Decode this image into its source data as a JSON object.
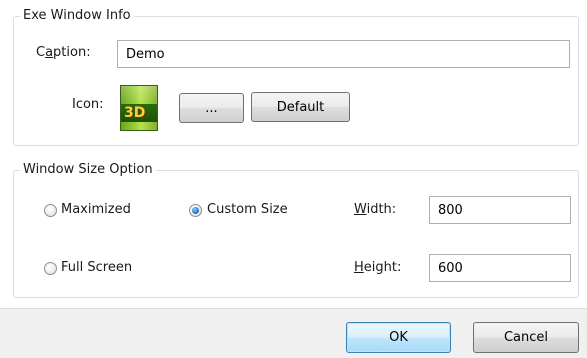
{
  "exe_window_info": {
    "legend": "Exe Window Info",
    "caption_label": "Caption:",
    "caption_value": "Demo",
    "icon_label": "Icon:",
    "icon_text": "3D",
    "browse_label": "...",
    "default_label": "Default"
  },
  "window_size_option": {
    "legend": "Window Size Option",
    "maximized_label": "Maximized",
    "custom_size_label": "Custom Size",
    "full_screen_label": "Full Screen",
    "selected": "Custom Size",
    "width_label": "Width:",
    "width_value": "800",
    "height_label": "Height:",
    "height_value": "600"
  },
  "buttons": {
    "ok_label": "OK",
    "cancel_label": "Cancel"
  },
  "colors": {
    "accent_radio": "#2b7cd3",
    "bottom_bar": "#f0f0f0",
    "group_border": "#d5dfe5"
  }
}
